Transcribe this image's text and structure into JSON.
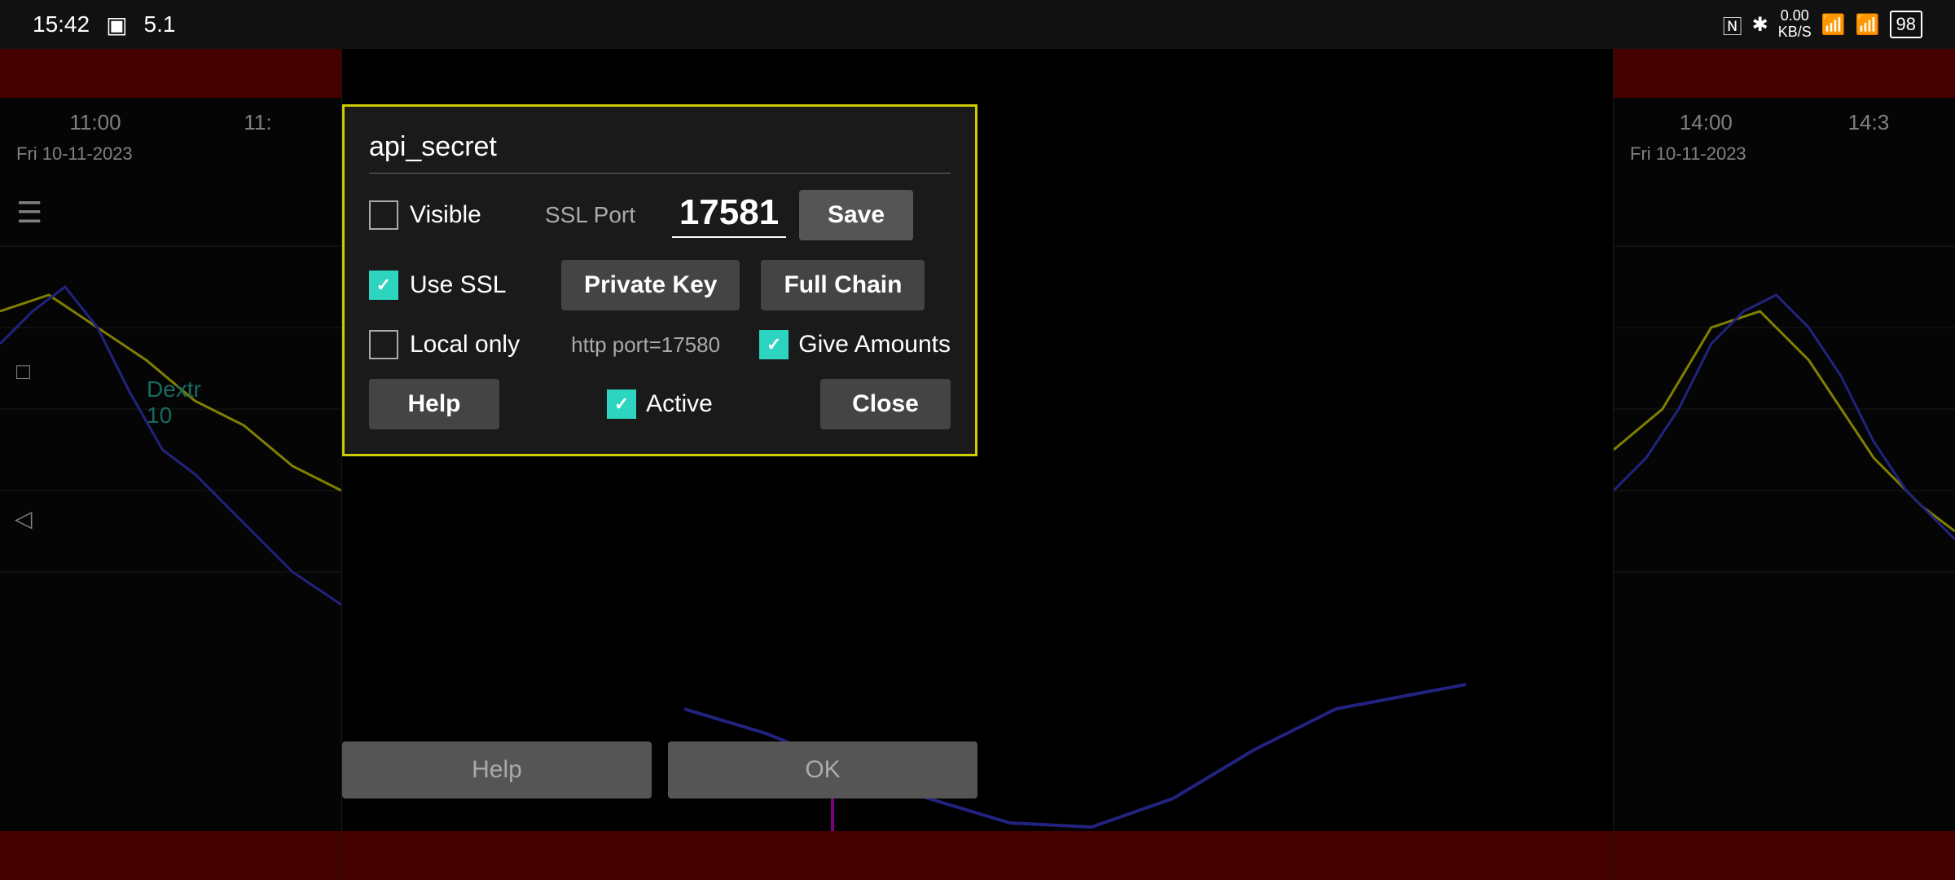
{
  "statusBar": {
    "time": "15:42",
    "batteryIcon": "▣",
    "indicator": "5.1",
    "rightIcons": {
      "nfc": "N",
      "bluetooth": "⚡",
      "speed": "0.00\nKB/S",
      "wifi": "WiFi",
      "signal": "|||",
      "battery": "98"
    }
  },
  "chartLeft": {
    "time1": "11:00",
    "time2": "11:",
    "date": "Fri 10-11-2023",
    "dextrLabel": "Dextr\n10"
  },
  "chartRight": {
    "time1": "14:00",
    "time2": "14:3",
    "date": "Fri 10-11-2023"
  },
  "dialog": {
    "title": "api_secret",
    "visibleLabel": "Visible",
    "visibleChecked": false,
    "sslPortLabel": "SSL Port",
    "sslPortValue": "17581",
    "saveLabel": "Save",
    "useSSLLabel": "Use SSL",
    "useSSLChecked": true,
    "privateKeyLabel": "Private Key",
    "fullChainLabel": "Full Chain",
    "localOnlyLabel": "Local only",
    "localOnlyChecked": false,
    "httpPortText": "http port=17580",
    "giveAmountsLabel": "Give Amounts",
    "giveAmountsChecked": true,
    "helpLabel": "Help",
    "activeLabel": "Active",
    "activeChecked": true,
    "closeLabel": "Close"
  },
  "bottomBar": {
    "helpLabel": "Help",
    "okLabel": "OK"
  }
}
